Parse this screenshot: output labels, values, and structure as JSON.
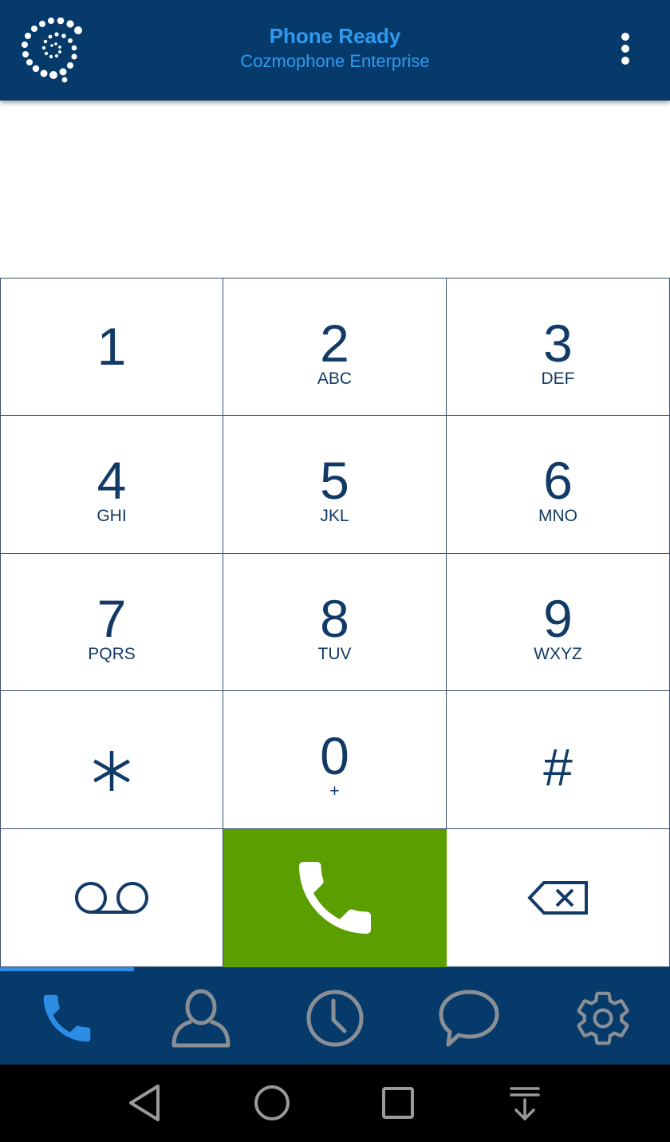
{
  "header": {
    "title": "Phone Ready",
    "subtitle": "Cozmophone Enterprise",
    "logo_icon": "spiral-dots-logo",
    "menu_icon": "more-vert-icon"
  },
  "display": {
    "number": ""
  },
  "keypad": {
    "keys": [
      {
        "digit": "1",
        "letters": ""
      },
      {
        "digit": "2",
        "letters": "ABC"
      },
      {
        "digit": "3",
        "letters": "DEF"
      },
      {
        "digit": "4",
        "letters": "GHI"
      },
      {
        "digit": "5",
        "letters": "JKL"
      },
      {
        "digit": "6",
        "letters": "MNO"
      },
      {
        "digit": "7",
        "letters": "PQRS"
      },
      {
        "digit": "8",
        "letters": "TUV"
      },
      {
        "digit": "9",
        "letters": "WXYZ"
      },
      {
        "digit": "*",
        "letters": ""
      },
      {
        "digit": "0",
        "letters": "+"
      },
      {
        "digit": "#",
        "letters": ""
      }
    ],
    "voicemail_icon": "voicemail-icon",
    "call_icon": "phone-icon",
    "backspace_icon": "backspace-icon"
  },
  "tabs": [
    {
      "name": "dialer",
      "icon": "phone-icon",
      "active": true
    },
    {
      "name": "contacts",
      "icon": "person-icon",
      "active": false
    },
    {
      "name": "history",
      "icon": "clock-icon",
      "active": false
    },
    {
      "name": "messages",
      "icon": "chat-bubble-icon",
      "active": false
    },
    {
      "name": "settings",
      "icon": "gear-icon",
      "active": false
    }
  ],
  "system_nav": [
    "back-icon",
    "home-icon",
    "recents-icon",
    "notifications-pulldown-icon"
  ],
  "colors": {
    "header_bg": "#063a6b",
    "accent_blue": "#2f9bf0",
    "key_text": "#123a66",
    "call_green": "#5a9e00",
    "tab_inactive": "#8a8f96"
  }
}
